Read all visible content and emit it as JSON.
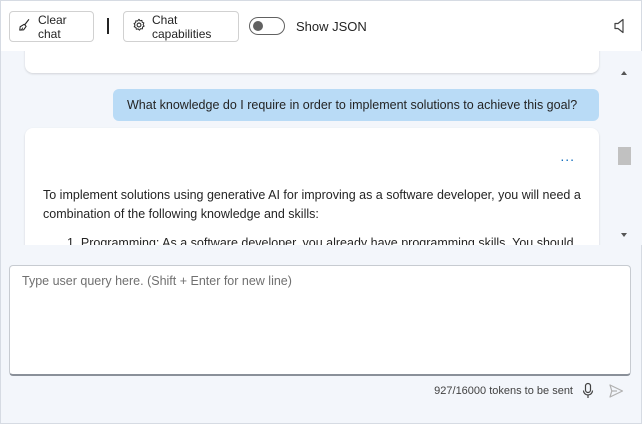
{
  "toolbar": {
    "clear_chat_label": "Clear chat",
    "chat_capabilities_label": "Chat capabilities",
    "show_json_label": "Show JSON",
    "show_json_on": false
  },
  "chat": {
    "user_message": "What knowledge do I require in order to implement solutions to achieve this goal?",
    "assistant_more": "...",
    "assistant_paragraph": "To implement solutions using generative AI for improving as a software developer, you will need a combination of the following knowledge and skills:",
    "assistant_list_item_1": "1. Programming: As a software developer, you already have programming skills. You should"
  },
  "input": {
    "placeholder": "Type user query here. (Shift + Enter for new line)",
    "value": ""
  },
  "footer": {
    "tokens_text": "927/16000 tokens to be sent"
  },
  "colors": {
    "user_bubble": "#b9dbf6",
    "accent": "#0f6cbd"
  },
  "icons": [
    "broom-icon",
    "gear-icon",
    "speaker-icon",
    "microphone-icon",
    "send-icon"
  ]
}
